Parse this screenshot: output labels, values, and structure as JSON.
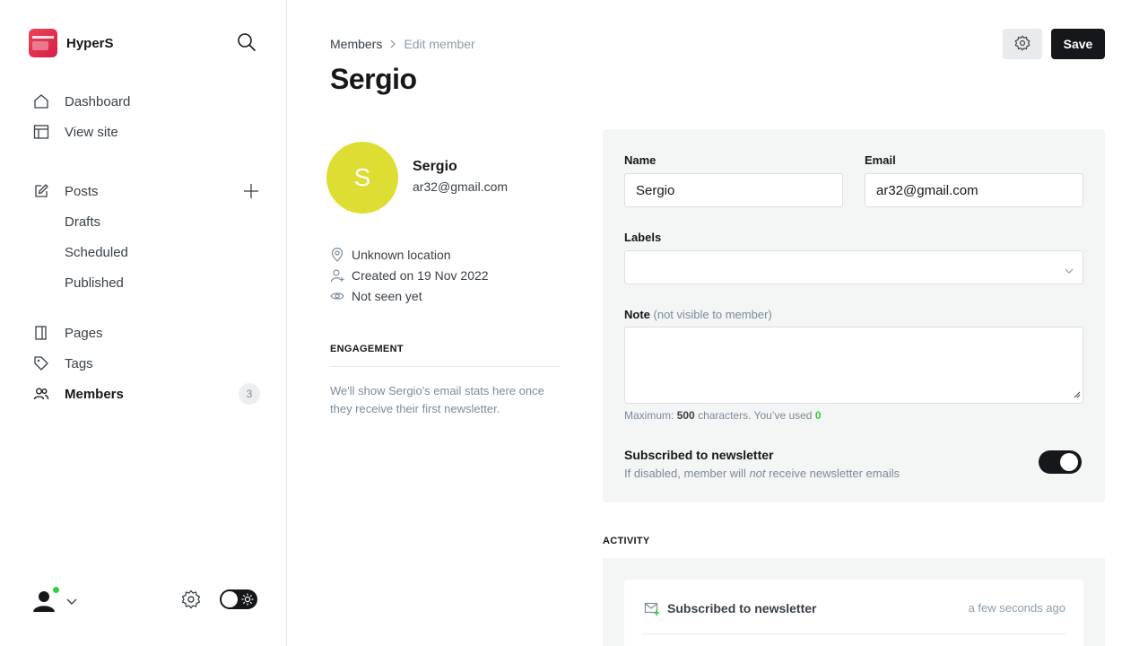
{
  "brand": {
    "name": "HyperS"
  },
  "sidebar": {
    "items": [
      {
        "label": "Dashboard"
      },
      {
        "label": "View site"
      },
      {
        "label": "Posts"
      },
      {
        "label": "Drafts"
      },
      {
        "label": "Scheduled"
      },
      {
        "label": "Published"
      },
      {
        "label": "Pages"
      },
      {
        "label": "Tags"
      },
      {
        "label": "Members",
        "count": "3"
      }
    ]
  },
  "breadcrumb": {
    "parent": "Members",
    "current": "Edit member"
  },
  "page": {
    "title": "Sergio"
  },
  "actions": {
    "save_label": "Save"
  },
  "member": {
    "initial": "S",
    "name": "Sergio",
    "email": "ar32@gmail.com",
    "location": "Unknown location",
    "created": "Created on 19 Nov 2022",
    "seen": "Not seen yet",
    "avatar_color": "#dedd33"
  },
  "engagement": {
    "title": "ENGAGEMENT",
    "text": "We'll show Sergio's email stats here once they receive their first newsletter."
  },
  "form": {
    "name_label": "Name",
    "name_value": "Sergio",
    "email_label": "Email",
    "email_value": "ar32@gmail.com",
    "labels_label": "Labels",
    "note_label": "Note",
    "note_hint": "(not visible to member)",
    "max_prefix": "Maximum:",
    "max_count": "500",
    "max_mid": "characters. You’ve used",
    "used_count": "0",
    "subscribed_title": "Subscribed to newsletter",
    "subscribed_desc_pre": "If disabled, member will",
    "subscribed_desc_em": "not",
    "subscribed_desc_post": "receive newsletter emails",
    "subscribed": true
  },
  "activity": {
    "title": "ACTIVITY",
    "items": [
      {
        "text": "Subscribed to newsletter",
        "time": "a few seconds ago"
      }
    ]
  },
  "colors": {
    "accent": "#15171a",
    "online": "#30cf43",
    "panel": "#f4f5f5"
  }
}
